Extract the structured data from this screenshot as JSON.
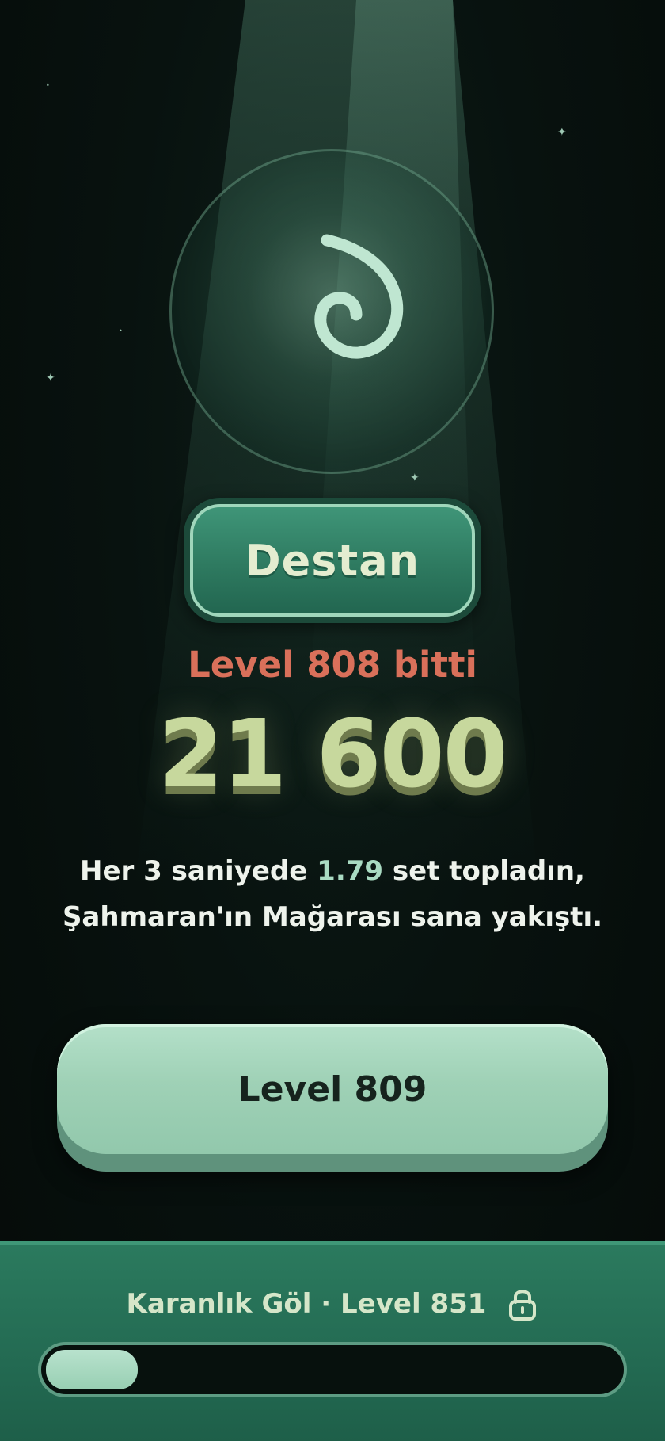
{
  "result": {
    "rank_label": "Destan",
    "level_done": "Level 808 bitti",
    "score": "21 600",
    "message": {
      "line1_prefix": "Her 3 saniyede ",
      "line1_highlight": "1.79",
      "line1_suffix": " set topladın,",
      "line2": "Şahmaran'ın Mağarası sana yakıştı."
    }
  },
  "next_button": {
    "label": "Level 809"
  },
  "destination": {
    "label": "Karanlık Göl · Level 851",
    "icon": "lock-icon",
    "progress": 0.16
  },
  "colors": {
    "accent_red": "#d9705a",
    "score": "#c7d89d",
    "highlight": "#a9dbc2",
    "button": "#a3d4ba",
    "panel": "#2b7a5e"
  }
}
